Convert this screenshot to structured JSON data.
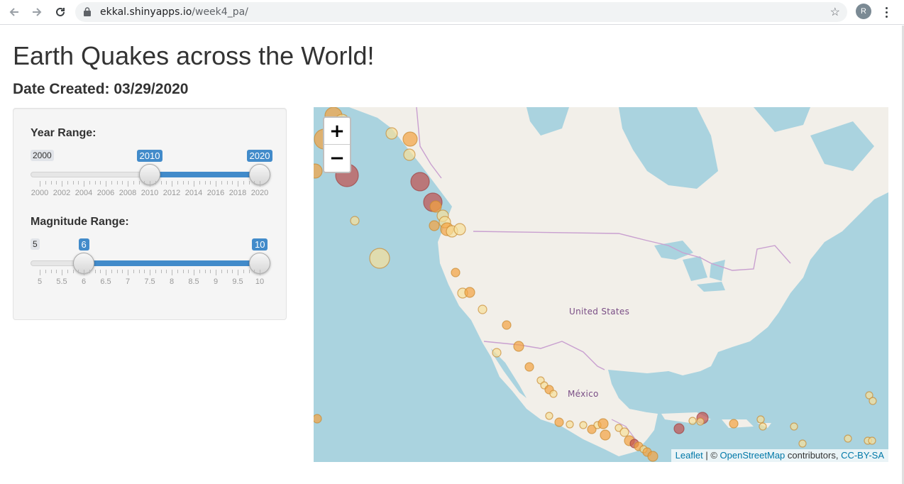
{
  "browser": {
    "url_host": "ekkal.shinyapps.io",
    "url_path": "/week4_pa/",
    "back_icon": "arrow-left-icon",
    "forward_icon": "arrow-right-icon",
    "reload_icon": "reload-icon",
    "avatar_initial": "R"
  },
  "header": {
    "title": "Earth Quakes across the World!",
    "subtitle": "Date Created: 03/29/2020"
  },
  "sidebar": {
    "year_range": {
      "label": "Year Range:",
      "min": 2000,
      "max": 2020,
      "from": 2010,
      "to": 2020,
      "min_label": "2000",
      "from_label": "2010",
      "to_label": "2020",
      "ticks": [
        "2000",
        "2002",
        "2004",
        "2006",
        "2008",
        "2010",
        "2012",
        "2014",
        "2016",
        "2018",
        "2020"
      ]
    },
    "magnitude_range": {
      "label": "Magnitude Range:",
      "min": 5,
      "max": 10,
      "from": 6,
      "to": 10,
      "min_label": "5",
      "from_label": "6",
      "to_label": "10",
      "ticks": [
        "5",
        "5.5",
        "6",
        "6.5",
        "7",
        "7.5",
        "8",
        "8.5",
        "9",
        "9.5",
        "10"
      ]
    }
  },
  "map": {
    "zoom_in": "+",
    "zoom_out": "−",
    "labels": {
      "us": "United States",
      "mexico": "México"
    },
    "attribution": {
      "leaflet": "Leaflet",
      "sep": " | © ",
      "osm": "OpenStreetMap",
      "contrib": " contributors, ",
      "license": "CC-BY-SA"
    },
    "colors": {
      "water": "#aad3df",
      "land": "#f2efe9",
      "border": "#c9a0d0",
      "marker_high": "#c0504d",
      "marker_mid": "#f4a340",
      "marker_low": "#f7e09a"
    }
  }
}
